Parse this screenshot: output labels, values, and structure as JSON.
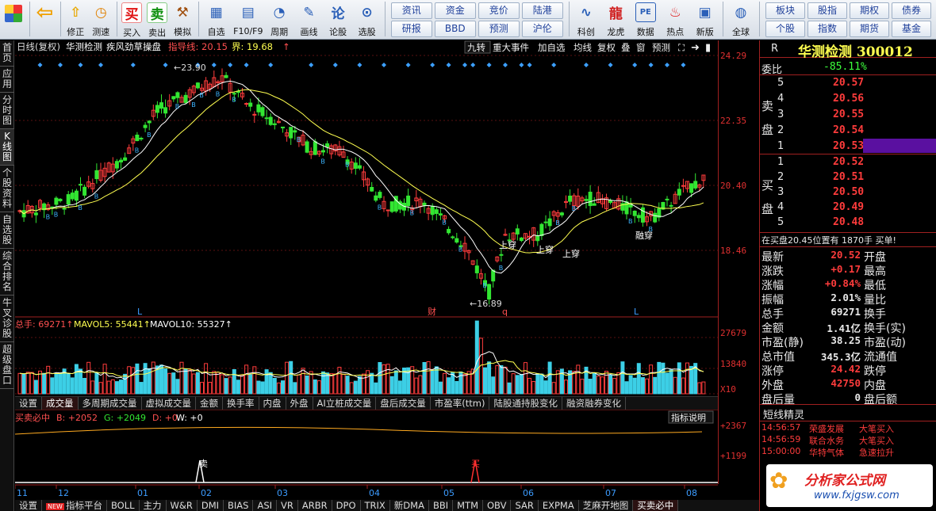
{
  "toolbar": {
    "buttons": [
      {
        "label": "",
        "icon": "windows-icon"
      },
      {
        "label": "",
        "icon": "back-arrow-icon"
      },
      {
        "label": "修正",
        "icon": "up-arrow-icon"
      },
      {
        "label": "测速",
        "icon": "timer-icon"
      },
      {
        "label": "买入",
        "icon": "buy-icon",
        "glyph": "买"
      },
      {
        "label": "卖出",
        "icon": "sell-icon",
        "glyph": "卖"
      },
      {
        "label": "模拟",
        "icon": "hammer-icon"
      }
    ],
    "buttons2": [
      {
        "label": "自选",
        "icon": "star-icon"
      },
      {
        "label": "F10/F9",
        "icon": "f10-icon"
      },
      {
        "label": "周期",
        "icon": "clock-icon"
      },
      {
        "label": "画线",
        "icon": "pencil-icon"
      },
      {
        "label": "论股",
        "icon": "chat-icon"
      },
      {
        "label": "选股",
        "icon": "search-chart-icon"
      }
    ],
    "grid1": [
      "资讯",
      "资金",
      "竞价",
      "陆港",
      "研报",
      "BBD",
      "预测",
      "沪伦"
    ],
    "buttons3": [
      {
        "label": "科创",
        "icon": "kechuang-icon"
      },
      {
        "label": "龙虎",
        "icon": "dragon-icon"
      },
      {
        "label": "数据",
        "icon": "pe-icon"
      },
      {
        "label": "热点",
        "icon": "hot-icon"
      },
      {
        "label": "新版",
        "icon": "newversion-icon"
      },
      {
        "label": "全球",
        "icon": "globe-icon"
      }
    ],
    "grid2": [
      "板块",
      "股指",
      "期权",
      "债券",
      "个股",
      "指数",
      "期货",
      "基金"
    ]
  },
  "chart_header": {
    "period": "日线(复权)",
    "name": "华测检测",
    "indicator": "疾风劲草操盘",
    "guide": "指导线: 20.15",
    "bound": "界: 19.68",
    "arrow": "↑",
    "buttons": [
      "九转",
      "重大事件",
      "加自选",
      "均线",
      "复权",
      "叠",
      "窗",
      "预测"
    ]
  },
  "price_axis": [
    "24.29",
    "22.35",
    "20.40",
    "18.46"
  ],
  "volume_axis": [
    "27679",
    "13840",
    "X10"
  ],
  "indicator_axis": [
    "+2367",
    "+1199"
  ],
  "annotations": {
    "high": "23.90",
    "low": "16.89",
    "shangya1": "上穿",
    "shangya2": "上穿",
    "shangya3": "上穿",
    "rongya": "融穿"
  },
  "markers": [
    "L",
    "财",
    "q",
    "L"
  ],
  "volume_header": {
    "total": "总手: 69271",
    "ma5": "MAVOL5: 55441",
    "ma10": "MAVOL10: 55327"
  },
  "tabs1": [
    "设置",
    "成交量",
    "多周期成交量",
    "虚拟成交量",
    "金额",
    "换手率",
    "内盘",
    "外盘",
    "AI立桩成交量",
    "盘后成交量",
    "市盈率(ttm)",
    "陆股通持股变化",
    "融资融券变化"
  ],
  "indicator_header": {
    "name": "买卖必中",
    "b": "B: +2052",
    "g": "G: +2049",
    "d": "D: +0",
    "w": "W: +0",
    "help": "指标说明"
  },
  "signals": {
    "buy": "买",
    "sell": "卖"
  },
  "months": [
    "11",
    "12",
    "01",
    "02",
    "03",
    "04",
    "05",
    "06",
    "07",
    "08"
  ],
  "tabs2": [
    "设置",
    "指标平台",
    "BOLL",
    "主力",
    "W&R",
    "DMI",
    "BIAS",
    "ASI",
    "VR",
    "ARBR",
    "DPO",
    "TRIX",
    "新DMA",
    "BBI",
    "MTM",
    "OBV",
    "SAR",
    "EXPMA",
    "芝麻开地图",
    "买卖必中"
  ],
  "left_tabs": [
    "首页",
    "应用",
    "分时图",
    "K线图",
    "个股资料",
    "自选股",
    "综合排名",
    "牛叉诊股",
    "超级盘口"
  ],
  "quote": {
    "r": "R",
    "title": "华测检测 300012",
    "weibi_label": "委比",
    "weibi": "-85.11%",
    "sell_label": "卖盘",
    "buy_label": "买盘",
    "asks": [
      {
        "n": "5",
        "p": "20.57"
      },
      {
        "n": "4",
        "p": "20.56"
      },
      {
        "n": "3",
        "p": "20.55"
      },
      {
        "n": "2",
        "p": "20.54"
      },
      {
        "n": "1",
        "p": "20.53"
      }
    ],
    "bids": [
      {
        "n": "1",
        "p": "20.52"
      },
      {
        "n": "2",
        "p": "20.51"
      },
      {
        "n": "3",
        "p": "20.50"
      },
      {
        "n": "4",
        "p": "20.49"
      },
      {
        "n": "5",
        "p": "20.48"
      }
    ],
    "ticker": "在买盘20.45位置有  1870手  买单!",
    "stats": [
      {
        "l1": "最新",
        "v1": "20.52",
        "l2": "开盘"
      },
      {
        "l1": "涨跌",
        "v1": "+0.17",
        "l2": "最高"
      },
      {
        "l1": "涨幅",
        "v1": "+0.84%",
        "l2": "最低"
      },
      {
        "l1": "振幅",
        "v1": "2.01%",
        "l2": "量比"
      },
      {
        "l1": "总手",
        "v1": "69271",
        "l2": "换手"
      },
      {
        "l1": "金额",
        "v1": "1.41亿",
        "l2": "换手(实)"
      },
      {
        "l1": "市盈(静)",
        "v1": "38.25",
        "l2": "市盈(动)"
      },
      {
        "l1": "总市值",
        "v1": "345.3亿",
        "l2": "流通值"
      },
      {
        "l1": "涨停",
        "v1": "24.42",
        "l2": "跌停"
      },
      {
        "l1": "外盘",
        "v1": "42750",
        "l2": "内盘"
      },
      {
        "l1": "盘后量",
        "v1": "0",
        "l2": "盘后额"
      }
    ],
    "sprite_title": "短线精灵",
    "sprites": [
      {
        "t": "14:56:57",
        "n": "荣盛发展",
        "e": "大笔买入"
      },
      {
        "t": "14:56:59",
        "n": "联合水务",
        "e": "大笔买入"
      },
      {
        "t": "15:00:00",
        "n": "华特气体",
        "e": "急速拉升"
      }
    ],
    "watermark": "分析家公式网",
    "watermark_url": "www.fxjgsw.com"
  },
  "colors": {
    "up": "#ff3c3c",
    "down": "#32e632",
    "ma1": "#ffffff",
    "ma2": "#ffff50",
    "vol_down": "#3ccfe6",
    "axis": "#a02020"
  }
}
